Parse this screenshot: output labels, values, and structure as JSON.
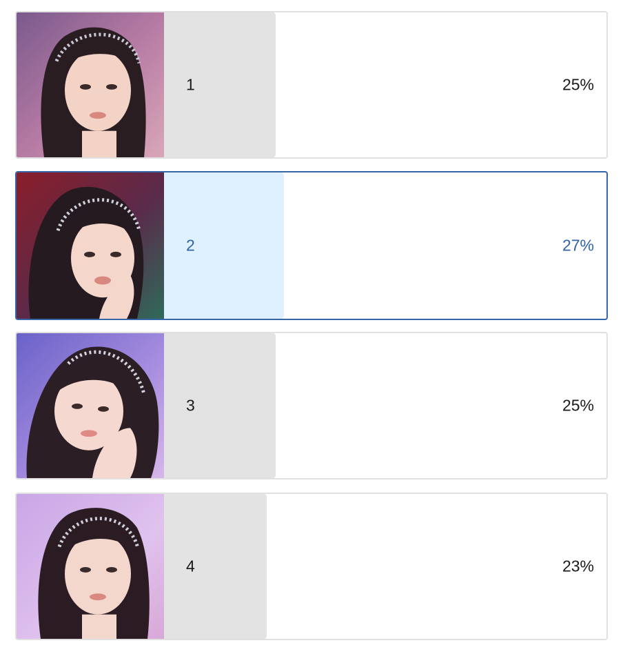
{
  "poll": {
    "options": [
      {
        "label": "1",
        "percent_text": "25%",
        "fraction": 0.25,
        "selected": false
      },
      {
        "label": "2",
        "percent_text": "27%",
        "fraction": 0.27,
        "selected": true
      },
      {
        "label": "3",
        "percent_text": "25%",
        "fraction": 0.25,
        "selected": false
      },
      {
        "label": "4",
        "percent_text": "23%",
        "fraction": 0.23,
        "selected": false
      }
    ]
  },
  "colors": {
    "selected_border": "#3466a8",
    "selected_text": "#2f63a6",
    "selected_bar": "#dff0ff",
    "bar": "#e3e3e3",
    "border": "#e0e0e0"
  }
}
